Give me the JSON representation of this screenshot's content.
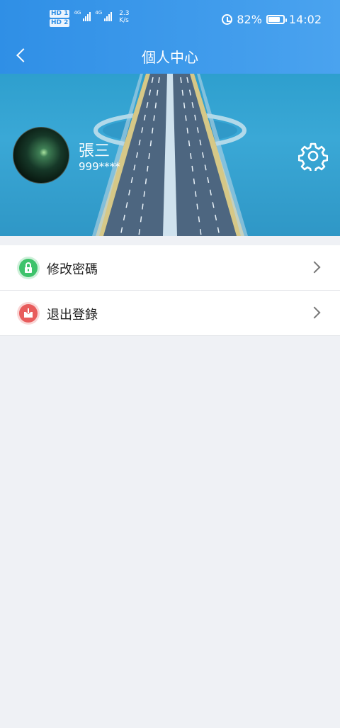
{
  "status_bar": {
    "hd1": "HD 1",
    "hd2": "HD 2",
    "net1": "4G",
    "net2": "4G",
    "speed_value": "2.3",
    "speed_unit": "K/s",
    "battery": "82%",
    "battery_level": 0.82,
    "time": "14:02",
    "icons": [
      "alarm-icon",
      "battery-icon",
      "signal-icon"
    ]
  },
  "header": {
    "title": "個人中心",
    "back_icon": "chevron-left-icon"
  },
  "profile": {
    "name": "張三",
    "account": "999****",
    "settings_icon": "gear-icon"
  },
  "menu": {
    "items": [
      {
        "label": "修改密碼",
        "icon": "lock-icon",
        "color": "#3ec36b"
      },
      {
        "label": "退出登錄",
        "icon": "logout-icon",
        "color": "#e85c5c"
      }
    ]
  },
  "colors": {
    "header_blue": "#3b98ea",
    "background": "#eff1f5"
  }
}
